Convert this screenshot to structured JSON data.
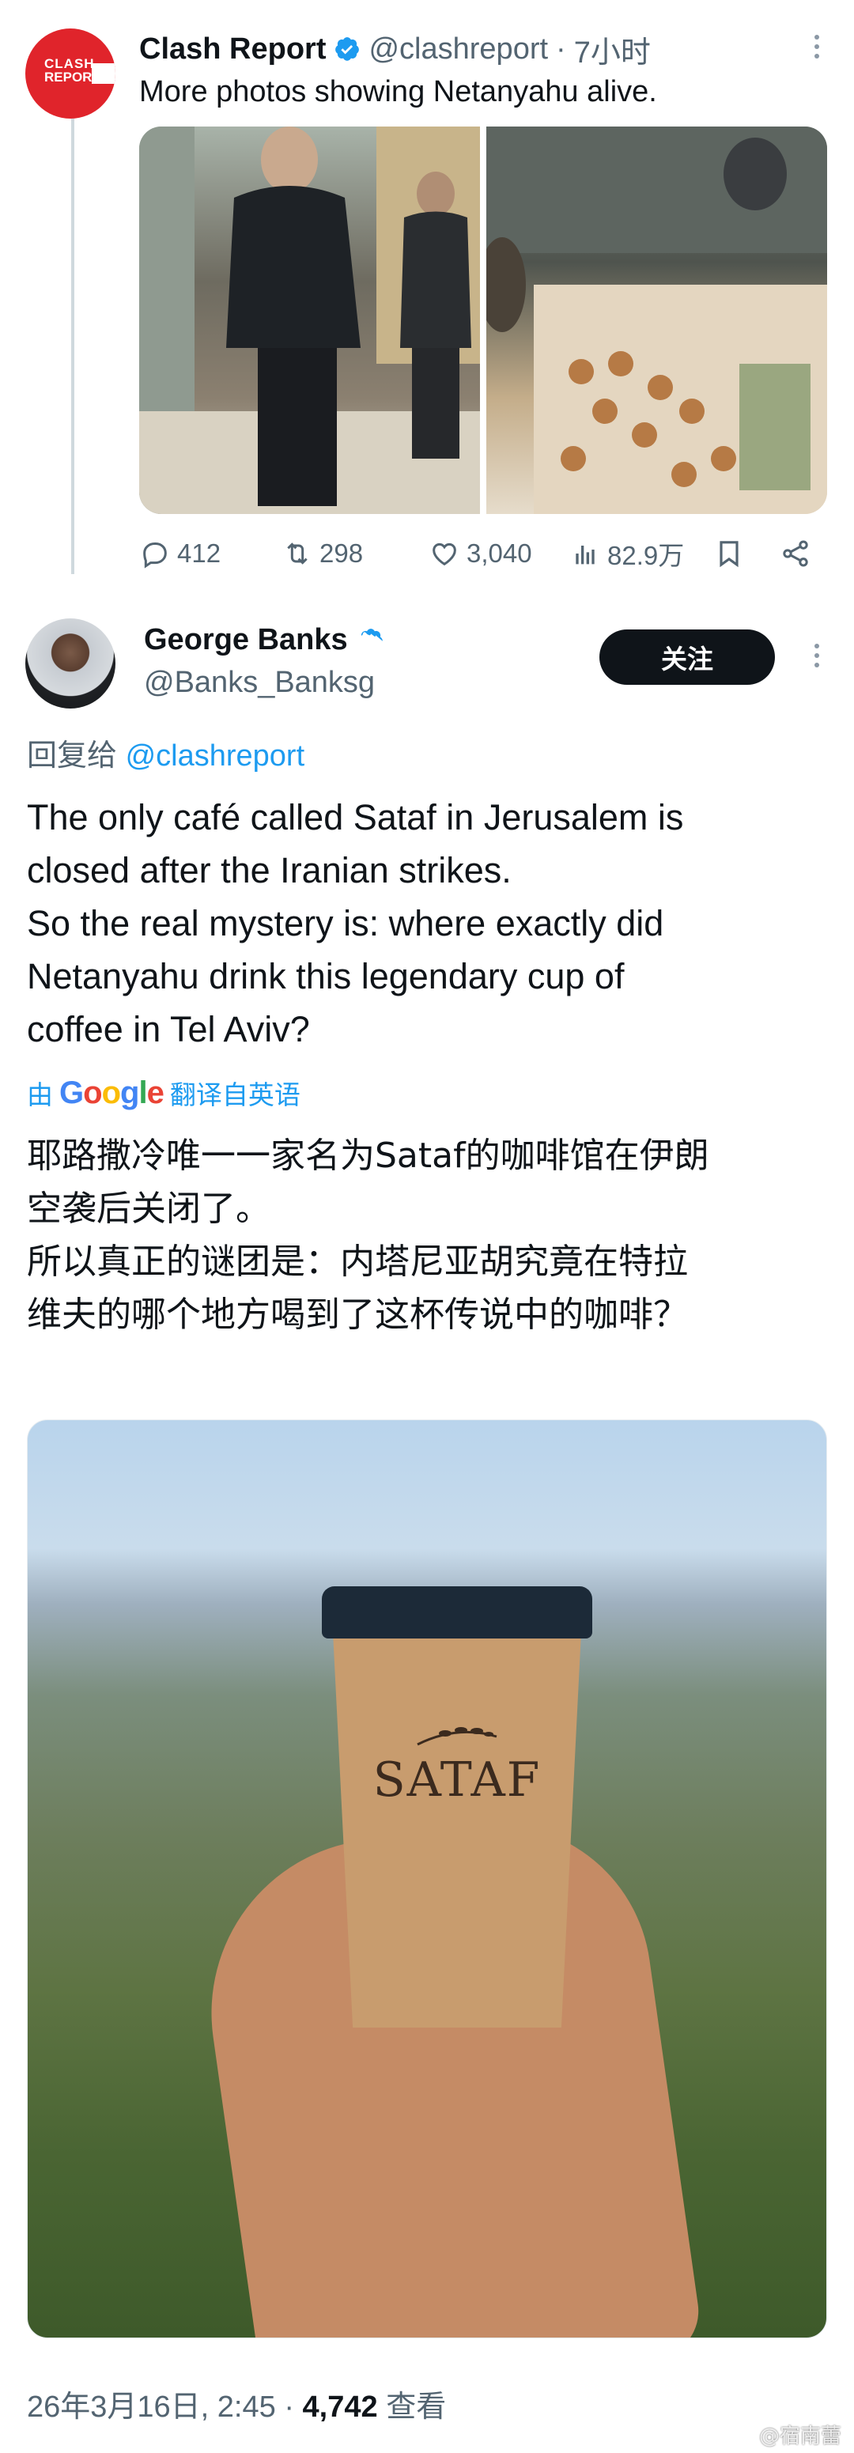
{
  "quoted_tweet": {
    "author_name": "Clash Report",
    "handle": "@clashreport",
    "separator": "·",
    "time": "7小时",
    "text": "More photos showing Netanyahu alive.",
    "avatar_logo": "CLASH REPORT",
    "media": [
      "photo-person-drinking-coffee",
      "photo-pastry-display-case"
    ],
    "stats": {
      "replies": "412",
      "retweets": "298",
      "likes": "3,040",
      "views": "82.9万"
    }
  },
  "main_tweet": {
    "author_name": "George Banks",
    "handle": "@Banks_Banksg",
    "follow_label": "关注",
    "reply_prefix": "回复给",
    "reply_mention": "@clashreport",
    "text_lines": [
      "The only café called Sataf in Jerusalem is",
      "closed after the Iranian strikes.",
      "So the real mystery is: where exactly did",
      "Netanyahu drink this legendary cup of",
      "coffee in Tel Aviv?"
    ],
    "translate_by": "由",
    "translate_logo": "Google",
    "translate_label": "翻译自英语",
    "translated_lines": [
      "耶路撒冷唯一一家名为Sataf的咖啡馆在伊朗",
      "空袭后关闭了。",
      "所以真正的谜团是：内塔尼亚胡究竟在特拉",
      "维夫的哪个地方喝到了这杯传说中的咖啡？"
    ],
    "image_cup_text": "SATAF",
    "timestamp": "26年3月16日, 2:45",
    "meta_separator": "·",
    "views_count": "4,742",
    "views_label": "查看"
  },
  "watermark": "@宿南蕾",
  "colors": {
    "accent": "#1d9bf0",
    "text": "#0f1419",
    "muted": "#536471",
    "clash_red": "#e0242b",
    "follow_button": "#0f1419"
  },
  "icons": [
    "verified-badge-icon",
    "more-icon",
    "reply-icon",
    "retweet-icon",
    "like-icon",
    "views-icon",
    "bookmark-icon",
    "share-icon"
  ]
}
